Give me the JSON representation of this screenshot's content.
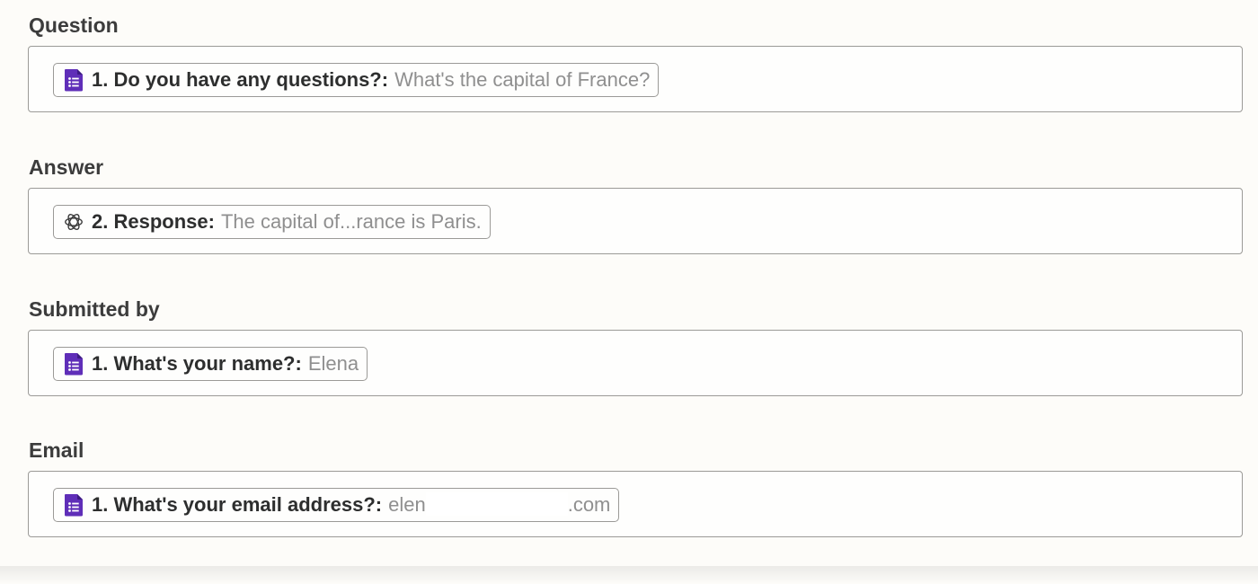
{
  "fields": [
    {
      "label": "Question",
      "pill": {
        "icon": "google-forms-icon",
        "key": "1. Do you have any questions?:",
        "value": "What's the capital of France?"
      }
    },
    {
      "label": "Answer",
      "pill": {
        "icon": "openai-icon",
        "key": "2. Response:",
        "value": "The capital of...rance is Paris."
      }
    },
    {
      "label": "Submitted by",
      "pill": {
        "icon": "google-forms-icon",
        "key": "1. What's your name?:",
        "value": "Elena"
      }
    },
    {
      "label": "Email",
      "pill": {
        "icon": "google-forms-icon",
        "key": "1. What's your email address?:",
        "value_prefix": "elen",
        "value_suffix": ".com"
      }
    }
  ],
  "colors": {
    "forms_purple": "#5f2eb8",
    "border": "#9b9a97",
    "muted_text": "#8f8f8f",
    "background": "#fdfcf9"
  }
}
